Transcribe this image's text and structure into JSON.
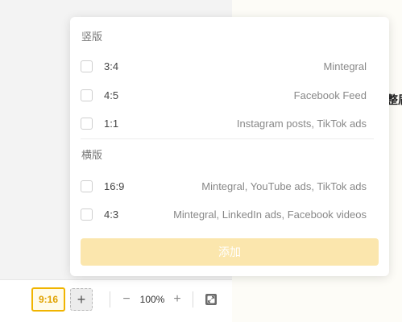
{
  "canvas": {
    "edge_text": "整届"
  },
  "toolbar": {
    "current_ratio": "9:16",
    "add_ratio_symbol": "+",
    "zoom_minus": "−",
    "zoom_value": "100%",
    "zoom_plus": "+"
  },
  "panel": {
    "portrait": {
      "title": "竖版",
      "items": [
        {
          "ratio": "3:4",
          "desc": "Mintegral"
        },
        {
          "ratio": "4:5",
          "desc": "Facebook Feed"
        },
        {
          "ratio": "1:1",
          "desc": "Instagram posts, TikTok ads"
        }
      ]
    },
    "landscape": {
      "title": "横版",
      "items": [
        {
          "ratio": "16:9",
          "desc": "Mintegral, YouTube ads, TikTok ads"
        },
        {
          "ratio": "4:3",
          "desc": "Mintegral, LinkedIn ads, Facebook videos"
        }
      ]
    },
    "add_label": "添加"
  },
  "colors": {
    "accent": "#f0b400",
    "add_button_bg": "#fbe6ad"
  }
}
